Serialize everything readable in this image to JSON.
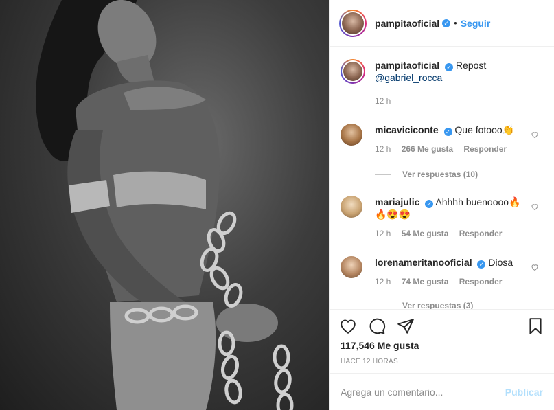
{
  "post": {
    "image_alt": "black and white photo"
  },
  "header": {
    "username": "pampitaoficial",
    "separator": "•",
    "follow_label": "Seguir"
  },
  "caption": {
    "username": "pampitaoficial",
    "text_line1": "Repost",
    "text_line2": "@gabriel_rocca",
    "time": "12 h"
  },
  "comments": [
    {
      "username": "micaviciconte",
      "text": "Que fotooo👏",
      "time": "12 h",
      "likes": "266 Me gusta",
      "reply": "Responder",
      "replies": "Ver respuestas (10)"
    },
    {
      "username": "mariajulic",
      "text": "Ahhhh buenoooo🔥",
      "text_line2": "🔥😍😍",
      "time": "12 h",
      "likes": "54 Me gusta",
      "reply": "Responder"
    },
    {
      "username": "lorenameritanooficial",
      "text": "Diosa",
      "time": "12 h",
      "likes": "74 Me gusta",
      "reply": "Responder",
      "replies": "Ver respuestas (3)"
    }
  ],
  "stats": {
    "likes": "117,546 Me gusta",
    "posted": "HACE 12 HORAS"
  },
  "composer": {
    "placeholder": "Agrega un comentario...",
    "submit": "Publicar"
  },
  "icons": {
    "like": "heart-icon",
    "comment": "comment-icon",
    "share": "share-icon",
    "save": "bookmark-icon",
    "verified": "verified-badge-icon"
  },
  "colors": {
    "link": "#3897f0",
    "muted": "#8e8e8e",
    "post_disabled": "#b2dffc"
  }
}
